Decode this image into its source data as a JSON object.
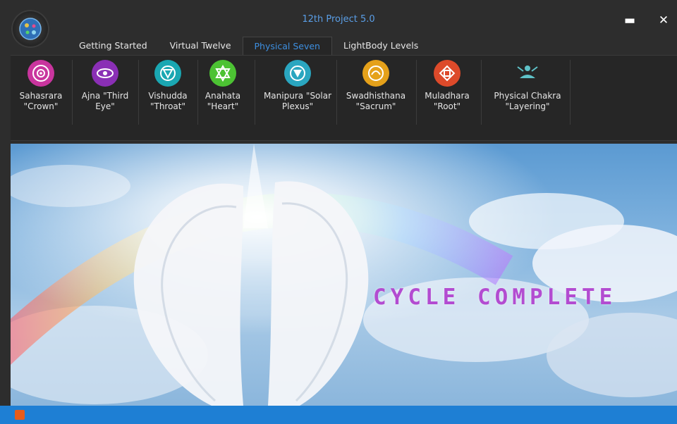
{
  "window": {
    "title": "12th Project 5.0"
  },
  "tabs": [
    {
      "label": "Getting Started"
    },
    {
      "label": "Virtual Twelve"
    },
    {
      "label": "Physical Seven"
    },
    {
      "label": "LightBody Levels"
    }
  ],
  "ribbon": {
    "buttons": [
      {
        "label": "Sahasrara \"Crown\"",
        "color": "#c9359e",
        "icon": "sahasrara-icon"
      },
      {
        "label": "Ajna \"Third Eye\"",
        "color": "#8a2fb5",
        "icon": "ajna-icon"
      },
      {
        "label": "Vishudda \"Throat\"",
        "color": "#1aa7b2",
        "icon": "vishudda-icon"
      },
      {
        "label": "Anahata \"Heart\"",
        "color": "#4cc233",
        "icon": "anahata-icon"
      },
      {
        "label": "Manipura \"Solar Plexus\"",
        "color": "#2aa6c0",
        "icon": "manipura-icon"
      },
      {
        "label": "Swadhisthana \"Sacrum\"",
        "color": "#e5a11a",
        "icon": "swadhisthana-icon"
      },
      {
        "label": "Muladhara \"Root\"",
        "color": "#dd4a2a",
        "icon": "muladhara-icon"
      },
      {
        "label": "Physical Chakra \"Layering\"",
        "color": "#5fc2c8",
        "icon": "layering-icon"
      }
    ]
  },
  "main": {
    "message": "CYCLE COMPLETE"
  },
  "colors": {
    "accent": "#3d8fe0",
    "message": "#b34cd1",
    "statusbar": "#1e7fd4"
  }
}
